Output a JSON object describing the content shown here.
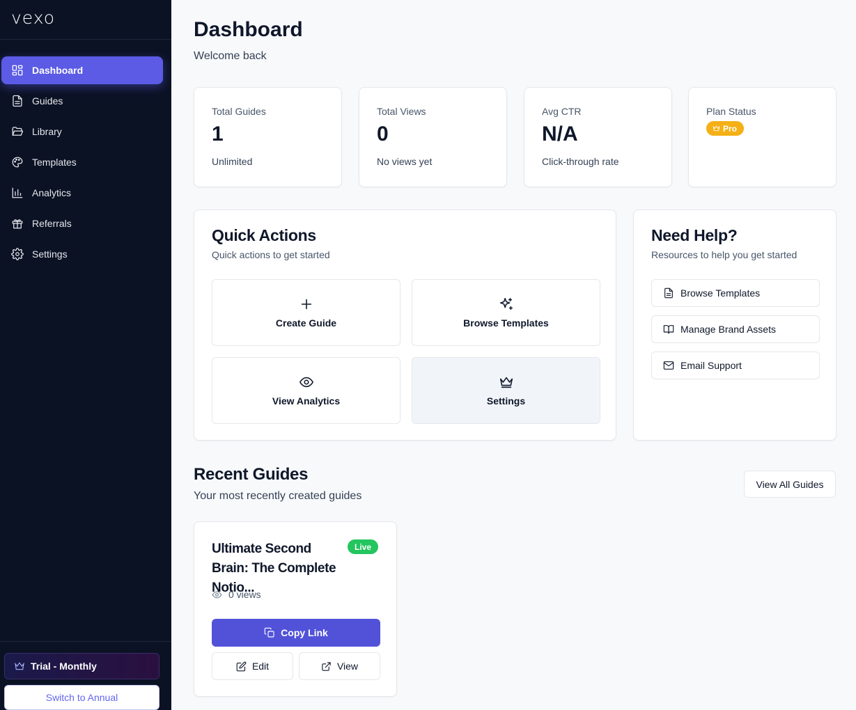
{
  "app": {
    "logo_text": "vexo"
  },
  "sidebar": {
    "items": [
      {
        "label": "Dashboard",
        "icon": "layout-grid-icon",
        "active": true
      },
      {
        "label": "Guides",
        "icon": "document-icon"
      },
      {
        "label": "Library",
        "icon": "folder-open-icon"
      },
      {
        "label": "Templates",
        "icon": "palette-icon"
      },
      {
        "label": "Analytics",
        "icon": "bar-chart-icon"
      },
      {
        "label": "Referrals",
        "icon": "gift-icon"
      },
      {
        "label": "Settings",
        "icon": "gear-icon"
      }
    ],
    "plan_label": "Trial - Monthly",
    "switch_label": "Switch to Annual"
  },
  "header": {
    "title": "Dashboard",
    "subtitle": "Welcome back"
  },
  "stats": [
    {
      "label": "Total Guides",
      "value": "1",
      "sub": "Unlimited"
    },
    {
      "label": "Total Views",
      "value": "0",
      "sub": "No views yet"
    },
    {
      "label": "Avg CTR",
      "value": "N/A",
      "sub": "Click-through rate"
    },
    {
      "label": "Plan Status",
      "badge": "Pro",
      "badge_color": "#f5b015"
    }
  ],
  "quick_actions": {
    "title": "Quick Actions",
    "subtitle": "Quick actions to get started",
    "tiles": [
      {
        "label": "Create Guide",
        "icon": "plus-icon"
      },
      {
        "label": "Browse Templates",
        "icon": "sparkles-icon"
      },
      {
        "label": "View Analytics",
        "icon": "eye-icon"
      },
      {
        "label": "Settings",
        "icon": "crown-icon"
      }
    ]
  },
  "help": {
    "title": "Need Help?",
    "subtitle": "Resources to help you get started",
    "links": [
      {
        "label": "Browse Templates",
        "icon": "document-icon"
      },
      {
        "label": "Manage Brand Assets",
        "icon": "book-open-icon"
      },
      {
        "label": "Email Support",
        "icon": "mail-icon"
      }
    ]
  },
  "recent": {
    "title": "Recent Guides",
    "subtitle": "Your most recently created guides",
    "view_all_label": "View All Guides",
    "guides": [
      {
        "title": "Ultimate Second Brain: The Complete Notio...",
        "status": "Live",
        "status_color": "#22c55e",
        "views": "0 views",
        "copy_label": "Copy Link",
        "edit_label": "Edit",
        "view_label": "View"
      }
    ]
  },
  "colors": {
    "accent": "#5b5be6",
    "sidebar_bg": "#0b1224",
    "pro": "#f5b015",
    "live": "#22c55e"
  }
}
